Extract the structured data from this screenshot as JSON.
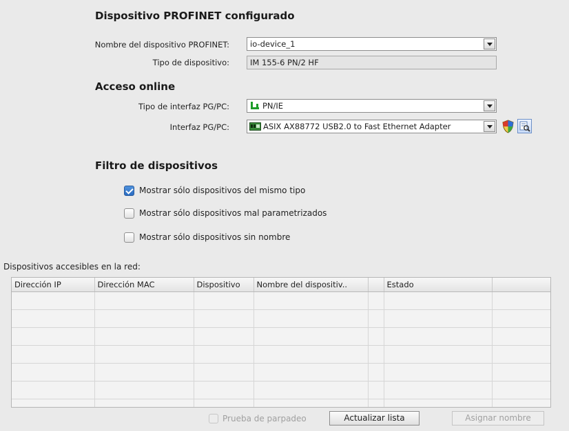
{
  "sections": {
    "configured_title": "Dispositivo PROFINET configurado",
    "online_title": "Acceso online",
    "filter_title": "Filtro de dispositivos"
  },
  "configured": {
    "name_label": "Nombre del dispositivo PROFINET:",
    "name_value": "io-device_1",
    "type_label": "Tipo de dispositivo:",
    "type_value": "IM 155-6 PN/2 HF"
  },
  "online": {
    "iface_type_label": "Tipo de interfaz PG/PC:",
    "iface_type_value": "PN/IE",
    "iface_label": "Interfaz PG/PC:",
    "iface_value": "ASIX AX88772 USB2.0 to Fast Ethernet Adapter",
    "icons": [
      "network-icon",
      "adapter-icon",
      "shield-icon",
      "diagnostics-icon"
    ]
  },
  "filter": {
    "options": [
      {
        "label": "Mostrar sólo dispositivos del mismo tipo",
        "checked": true
      },
      {
        "label": "Mostrar sólo dispositivos mal parametrizados",
        "checked": false
      },
      {
        "label": "Mostrar sólo dispositivos sin nombre",
        "checked": false
      }
    ]
  },
  "devices": {
    "caption": "Dispositivos accesibles en la red:",
    "columns": [
      "Dirección IP",
      "Dirección MAC",
      "Dispositivo",
      "Nombre del dispositiv..",
      "",
      "Estado",
      ""
    ],
    "rows": []
  },
  "footer": {
    "blink_label": "Prueba de parpadeo",
    "refresh_label": "Actualizar lista",
    "assign_label": "Asignar nombre"
  },
  "colors": {
    "background": "#eaeaea",
    "checkbox_checked": "#2a6cc2",
    "network_icon_green": "#1e9c2a"
  }
}
